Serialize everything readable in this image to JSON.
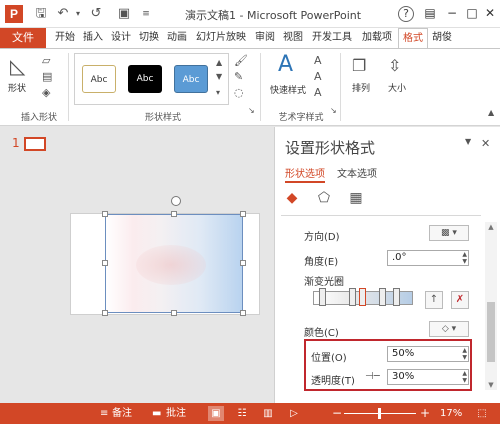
{
  "window": {
    "title": "演示文稿1 - Microsoft PowerPoint",
    "app_logo": "P",
    "help": "?"
  },
  "quick_access": {
    "icons": [
      "save-icon",
      "undo-icon",
      "redo-icon",
      "camera-icon",
      "customize-icon"
    ]
  },
  "tabs": {
    "file": "文件",
    "items": [
      "开始",
      "插入",
      "设计",
      "切换",
      "动画",
      "幻灯片放映",
      "审阅",
      "视图",
      "开发工具",
      "加载项",
      "格式"
    ],
    "active": "格式",
    "user": "胡俊"
  },
  "ribbon": {
    "shape_button": "形状",
    "insert_shape_group": "插入形状",
    "shape_styles_group": "形状样式",
    "style_swatch_text": "Abc",
    "quick_styles": "快速样式",
    "art_text_group": "艺术字样式",
    "arrange": "排列",
    "size": "大小"
  },
  "thumbnails": {
    "slide_number": "1"
  },
  "format_pane": {
    "title": "设置形状格式",
    "subtabs": [
      "形状选项",
      "文本选项"
    ],
    "active_subtab": "形状选项",
    "direction_label": "方向(D)",
    "angle_label": "角度(E)",
    "angle_value": ".0°",
    "gradient_stops_label": "渐变光圈",
    "color_label": "颜色(C)",
    "position_label": "位置(O)",
    "position_value": "50%",
    "transparency_label": "透明度(T)",
    "transparency_value": "30%"
  },
  "statusbar": {
    "notes": "备注",
    "comments": "批注",
    "zoom": "17%"
  },
  "colors": {
    "accent": "#d24726",
    "highlight": "#c0272d"
  }
}
